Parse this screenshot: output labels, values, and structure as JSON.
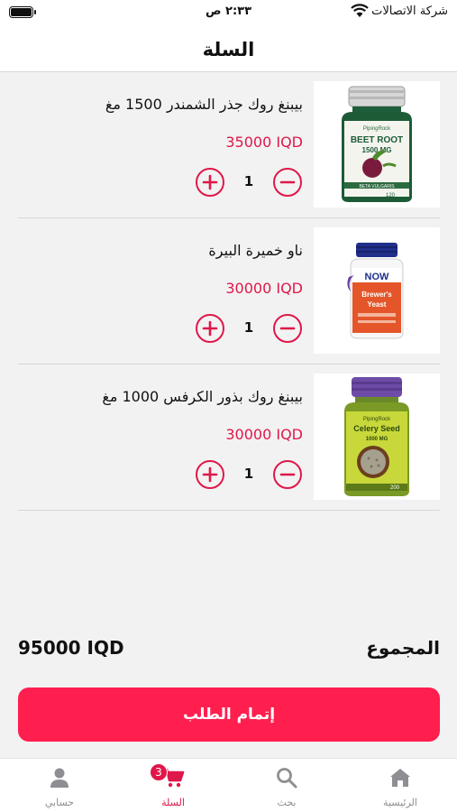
{
  "status_bar": {
    "carrier": "شركة الاتصالات",
    "time": "٢:٣٣ ص"
  },
  "header": {
    "title": "السلة"
  },
  "cart": {
    "items": [
      {
        "name": "بيبنغ روك جذر الشمندر 1500 مغ",
        "price": "35000 IQD",
        "quantity": "1",
        "image_icon": "beet-root-bottle-icon"
      },
      {
        "name": "ناو خميرة البيرة",
        "price": "30000 IQD",
        "quantity": "1",
        "image_icon": "brewers-yeast-bottle-icon"
      },
      {
        "name": "بيبنغ روك بذور الكرفس 1000 مغ",
        "price": "30000 IQD",
        "quantity": "1",
        "image_icon": "celery-seed-bottle-icon"
      }
    ]
  },
  "product_labels": {
    "beet": {
      "brand": "PipingRock",
      "line1": "BEET ROOT",
      "line2": "1500 MG",
      "line3": "BETA VULGARIS",
      "count": "120"
    },
    "yeast": {
      "brand": "NOW",
      "line1": "Brewer's",
      "line2": "Yeast"
    },
    "celery": {
      "brand": "PipingRock",
      "line1": "Celery Seed",
      "line2": "1000 MG",
      "count": "200"
    }
  },
  "summary": {
    "total_label": "المجموع",
    "total_value": "95000 IQD"
  },
  "checkout": {
    "label": "إتمام الطلب"
  },
  "tab_bar": {
    "tabs": [
      {
        "label": "الرئيسية",
        "icon": "home-icon"
      },
      {
        "label": "بحث",
        "icon": "search-icon"
      },
      {
        "label": "السلة",
        "icon": "cart-icon",
        "badge": "3",
        "active": true
      },
      {
        "label": "حسابي",
        "icon": "person-icon"
      }
    ]
  },
  "colors": {
    "accent": "#ff1f4f",
    "price": "#e0174a",
    "background": "#f2f2f2"
  }
}
